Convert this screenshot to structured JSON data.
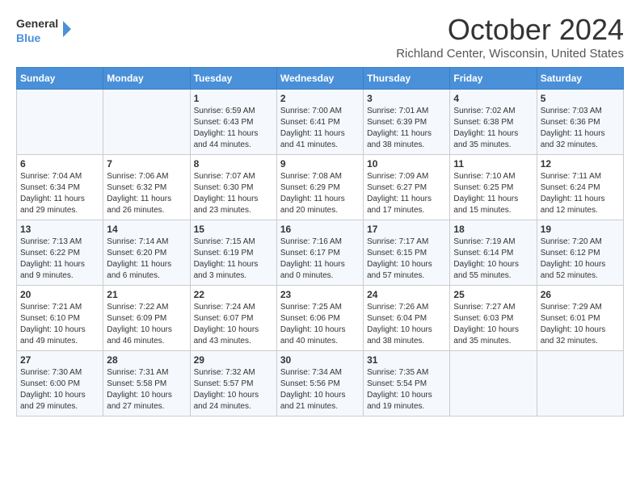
{
  "header": {
    "logo_line1": "General",
    "logo_line2": "Blue",
    "month_title": "October 2024",
    "location": "Richland Center, Wisconsin, United States"
  },
  "days_of_week": [
    "Sunday",
    "Monday",
    "Tuesday",
    "Wednesday",
    "Thursday",
    "Friday",
    "Saturday"
  ],
  "weeks": [
    [
      {
        "day": "",
        "info": ""
      },
      {
        "day": "",
        "info": ""
      },
      {
        "day": "1",
        "info": "Sunrise: 6:59 AM\nSunset: 6:43 PM\nDaylight: 11 hours and 44 minutes."
      },
      {
        "day": "2",
        "info": "Sunrise: 7:00 AM\nSunset: 6:41 PM\nDaylight: 11 hours and 41 minutes."
      },
      {
        "day": "3",
        "info": "Sunrise: 7:01 AM\nSunset: 6:39 PM\nDaylight: 11 hours and 38 minutes."
      },
      {
        "day": "4",
        "info": "Sunrise: 7:02 AM\nSunset: 6:38 PM\nDaylight: 11 hours and 35 minutes."
      },
      {
        "day": "5",
        "info": "Sunrise: 7:03 AM\nSunset: 6:36 PM\nDaylight: 11 hours and 32 minutes."
      }
    ],
    [
      {
        "day": "6",
        "info": "Sunrise: 7:04 AM\nSunset: 6:34 PM\nDaylight: 11 hours and 29 minutes."
      },
      {
        "day": "7",
        "info": "Sunrise: 7:06 AM\nSunset: 6:32 PM\nDaylight: 11 hours and 26 minutes."
      },
      {
        "day": "8",
        "info": "Sunrise: 7:07 AM\nSunset: 6:30 PM\nDaylight: 11 hours and 23 minutes."
      },
      {
        "day": "9",
        "info": "Sunrise: 7:08 AM\nSunset: 6:29 PM\nDaylight: 11 hours and 20 minutes."
      },
      {
        "day": "10",
        "info": "Sunrise: 7:09 AM\nSunset: 6:27 PM\nDaylight: 11 hours and 17 minutes."
      },
      {
        "day": "11",
        "info": "Sunrise: 7:10 AM\nSunset: 6:25 PM\nDaylight: 11 hours and 15 minutes."
      },
      {
        "day": "12",
        "info": "Sunrise: 7:11 AM\nSunset: 6:24 PM\nDaylight: 11 hours and 12 minutes."
      }
    ],
    [
      {
        "day": "13",
        "info": "Sunrise: 7:13 AM\nSunset: 6:22 PM\nDaylight: 11 hours and 9 minutes."
      },
      {
        "day": "14",
        "info": "Sunrise: 7:14 AM\nSunset: 6:20 PM\nDaylight: 11 hours and 6 minutes."
      },
      {
        "day": "15",
        "info": "Sunrise: 7:15 AM\nSunset: 6:19 PM\nDaylight: 11 hours and 3 minutes."
      },
      {
        "day": "16",
        "info": "Sunrise: 7:16 AM\nSunset: 6:17 PM\nDaylight: 11 hours and 0 minutes."
      },
      {
        "day": "17",
        "info": "Sunrise: 7:17 AM\nSunset: 6:15 PM\nDaylight: 10 hours and 57 minutes."
      },
      {
        "day": "18",
        "info": "Sunrise: 7:19 AM\nSunset: 6:14 PM\nDaylight: 10 hours and 55 minutes."
      },
      {
        "day": "19",
        "info": "Sunrise: 7:20 AM\nSunset: 6:12 PM\nDaylight: 10 hours and 52 minutes."
      }
    ],
    [
      {
        "day": "20",
        "info": "Sunrise: 7:21 AM\nSunset: 6:10 PM\nDaylight: 10 hours and 49 minutes."
      },
      {
        "day": "21",
        "info": "Sunrise: 7:22 AM\nSunset: 6:09 PM\nDaylight: 10 hours and 46 minutes."
      },
      {
        "day": "22",
        "info": "Sunrise: 7:24 AM\nSunset: 6:07 PM\nDaylight: 10 hours and 43 minutes."
      },
      {
        "day": "23",
        "info": "Sunrise: 7:25 AM\nSunset: 6:06 PM\nDaylight: 10 hours and 40 minutes."
      },
      {
        "day": "24",
        "info": "Sunrise: 7:26 AM\nSunset: 6:04 PM\nDaylight: 10 hours and 38 minutes."
      },
      {
        "day": "25",
        "info": "Sunrise: 7:27 AM\nSunset: 6:03 PM\nDaylight: 10 hours and 35 minutes."
      },
      {
        "day": "26",
        "info": "Sunrise: 7:29 AM\nSunset: 6:01 PM\nDaylight: 10 hours and 32 minutes."
      }
    ],
    [
      {
        "day": "27",
        "info": "Sunrise: 7:30 AM\nSunset: 6:00 PM\nDaylight: 10 hours and 29 minutes."
      },
      {
        "day": "28",
        "info": "Sunrise: 7:31 AM\nSunset: 5:58 PM\nDaylight: 10 hours and 27 minutes."
      },
      {
        "day": "29",
        "info": "Sunrise: 7:32 AM\nSunset: 5:57 PM\nDaylight: 10 hours and 24 minutes."
      },
      {
        "day": "30",
        "info": "Sunrise: 7:34 AM\nSunset: 5:56 PM\nDaylight: 10 hours and 21 minutes."
      },
      {
        "day": "31",
        "info": "Sunrise: 7:35 AM\nSunset: 5:54 PM\nDaylight: 10 hours and 19 minutes."
      },
      {
        "day": "",
        "info": ""
      },
      {
        "day": "",
        "info": ""
      }
    ]
  ]
}
